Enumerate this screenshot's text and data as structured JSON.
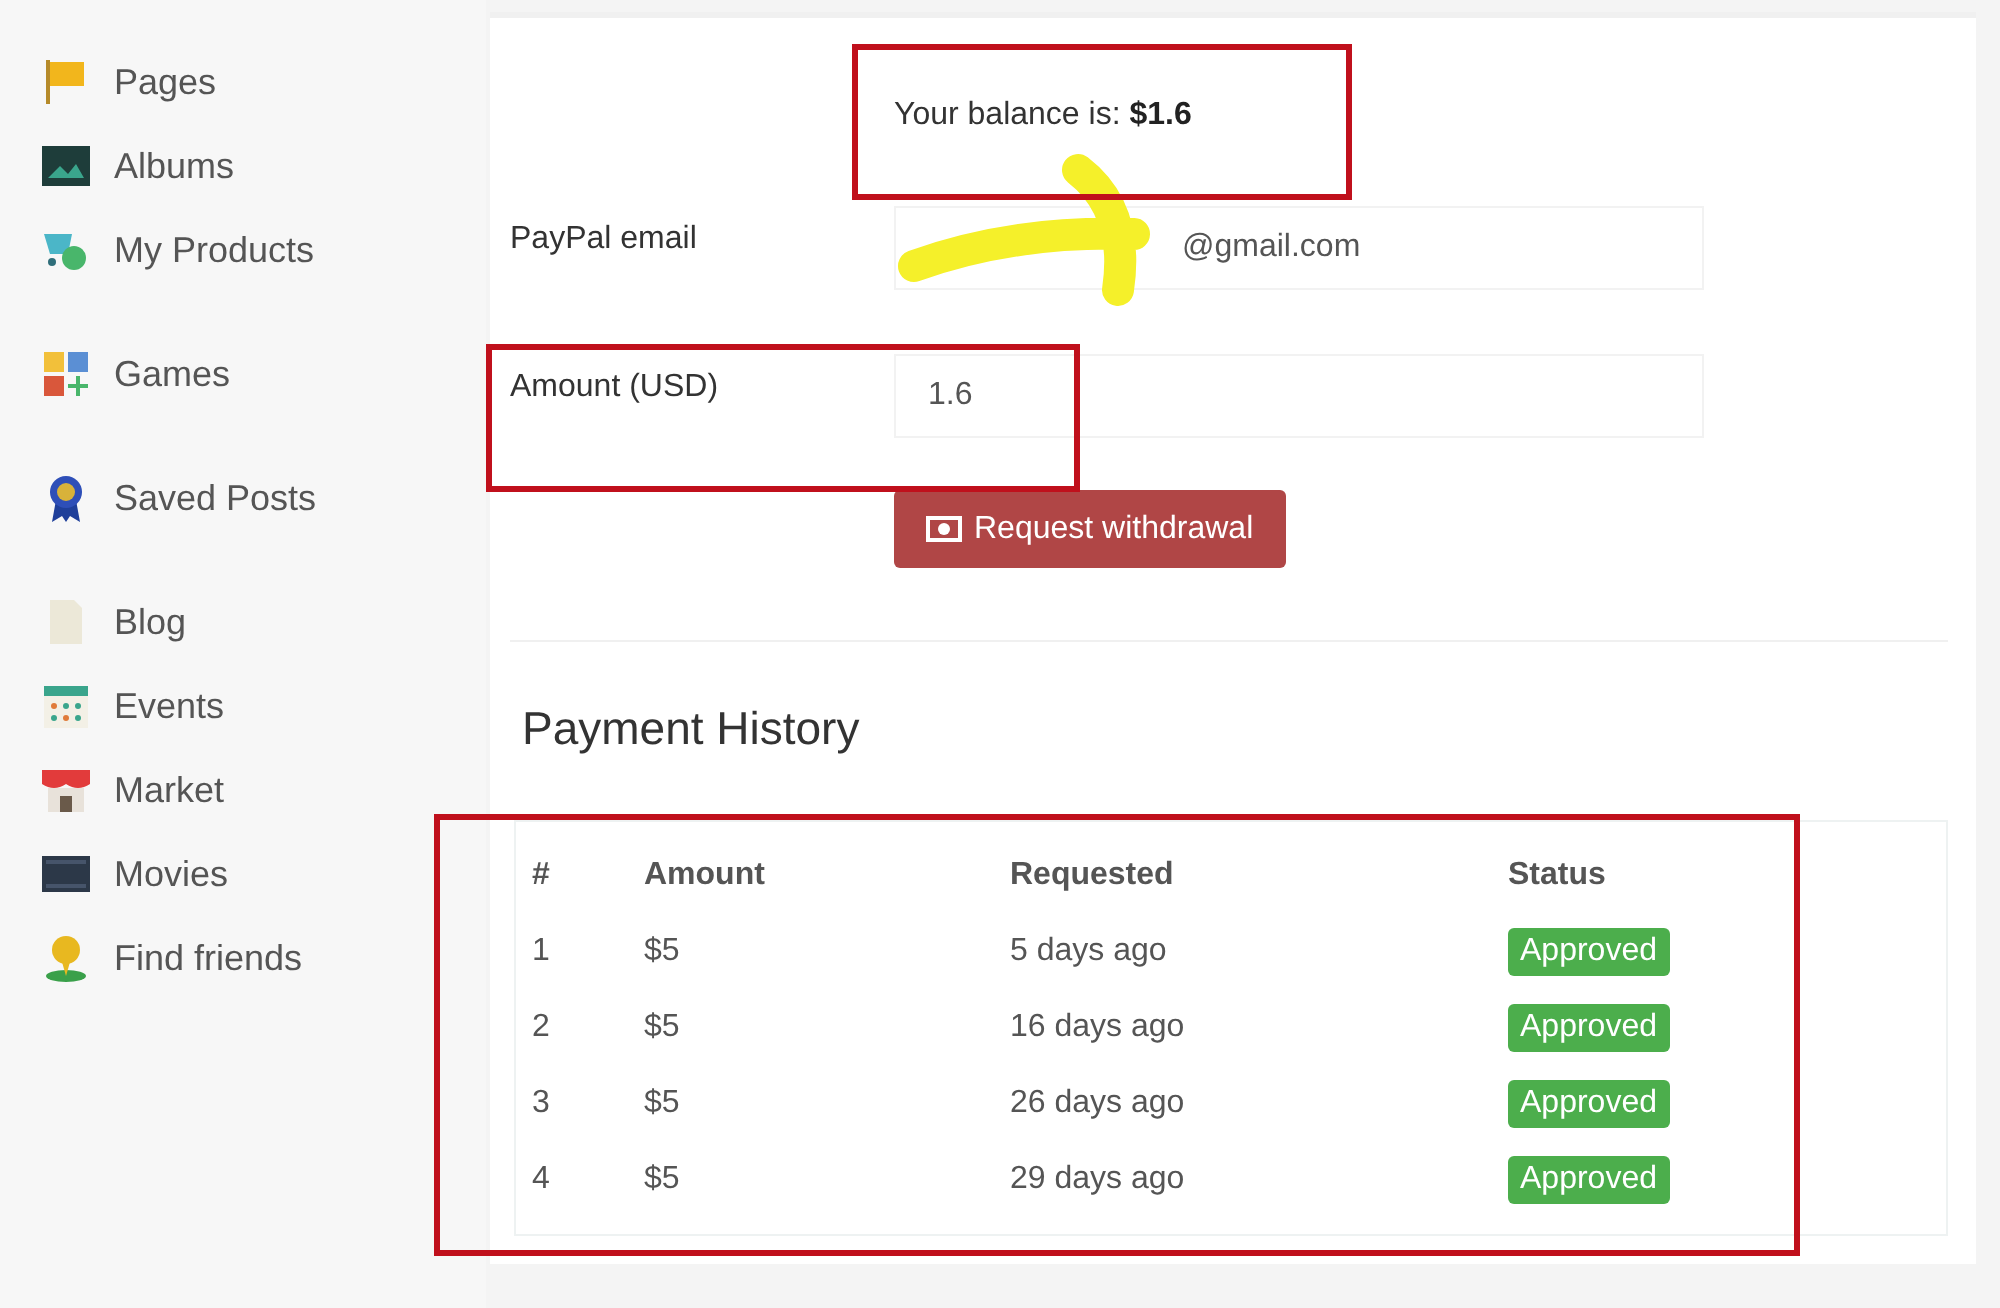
{
  "sidebar": {
    "groups": [
      {
        "items": [
          {
            "label": "Pages"
          },
          {
            "label": "Albums"
          },
          {
            "label": "My Products"
          }
        ]
      },
      {
        "items": [
          {
            "label": "Games"
          }
        ]
      },
      {
        "items": [
          {
            "label": "Saved Posts"
          }
        ]
      },
      {
        "items": [
          {
            "label": "Blog"
          },
          {
            "label": "Events"
          },
          {
            "label": "Market"
          },
          {
            "label": "Movies"
          },
          {
            "label": "Find friends"
          }
        ]
      }
    ]
  },
  "withdraw": {
    "balance": "Your balance is: **$1.6**",
    "fields": [
      {
        "label": "PayPal email",
        "value": "@gmail.com",
        "scribbled": true
      },
      {
        "label": "Amount (USD)",
        "value": "1.6",
        "scribbled": false
      }
    ],
    "button": "Request withdrawal"
  },
  "history": {
    "title": "Payment History",
    "columns": [
      "#",
      "Amount",
      "Requested",
      "Status"
    ],
    "rows": [
      {
        "cells": [
          "1",
          "$5",
          "5 days ago"
        ],
        "status": "Approved"
      },
      {
        "cells": [
          "2",
          "$5",
          "16 days ago"
        ],
        "status": "Approved"
      },
      {
        "cells": [
          "3",
          "$5",
          "26 days ago"
        ],
        "status": "Approved"
      },
      {
        "cells": [
          "4",
          "$5",
          "29 days ago"
        ],
        "status": "Approved"
      }
    ]
  }
}
